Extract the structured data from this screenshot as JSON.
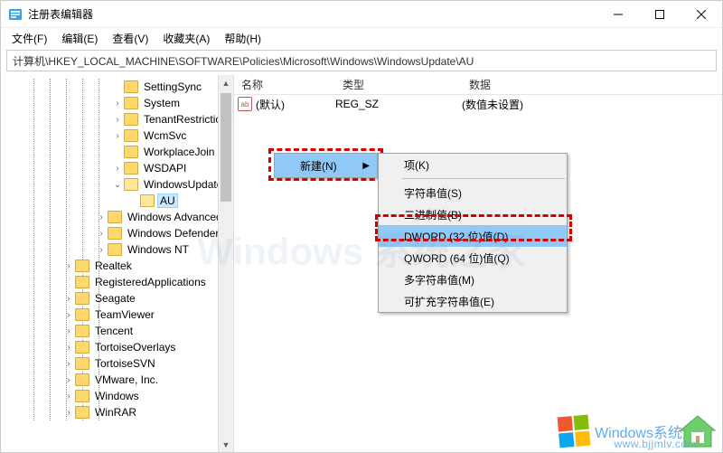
{
  "window": {
    "title": "注册表编辑器"
  },
  "menu": {
    "file": "文件(F)",
    "edit": "编辑(E)",
    "view": "查看(V)",
    "fav": "收藏夹(A)",
    "help": "帮助(H)"
  },
  "address": "计算机\\HKEY_LOCAL_MACHINE\\SOFTWARE\\Policies\\Microsoft\\Windows\\WindowsUpdate\\AU",
  "tree": {
    "items": [
      "SettingSync",
      "System",
      "TenantRestriction",
      "WcmSvc",
      "WorkplaceJoin",
      "WSDAPI",
      "WindowsUpdate",
      "AU",
      "Windows Advanced",
      "Windows Defender",
      "Windows NT",
      "Realtek",
      "RegisteredApplications",
      "Seagate",
      "TeamViewer",
      "Tencent",
      "TortoiseOverlays",
      "TortoiseSVN",
      "VMware, Inc.",
      "Windows",
      "WinRAR"
    ]
  },
  "columns": {
    "name": "名称",
    "type": "类型",
    "data": "数据"
  },
  "row": {
    "name": "(默认)",
    "type": "REG_SZ",
    "data": "(数值未设置)",
    "icon": "ab"
  },
  "ctx1": {
    "new": "新建(N)"
  },
  "ctx2": {
    "key": "项(K)",
    "string": "字符串值(S)",
    "binary": "二进制值(B)",
    "dword": "DWORD (32 位)值(D)",
    "qword": "QWORD (64 位)值(Q)",
    "multi": "多字符串值(M)",
    "expand": "可扩充字符串值(E)"
  },
  "watermark": {
    "brand": "Windows系统之家",
    "url": "www.bjjmlv.com",
    "faint": "Windows 系统之家"
  }
}
